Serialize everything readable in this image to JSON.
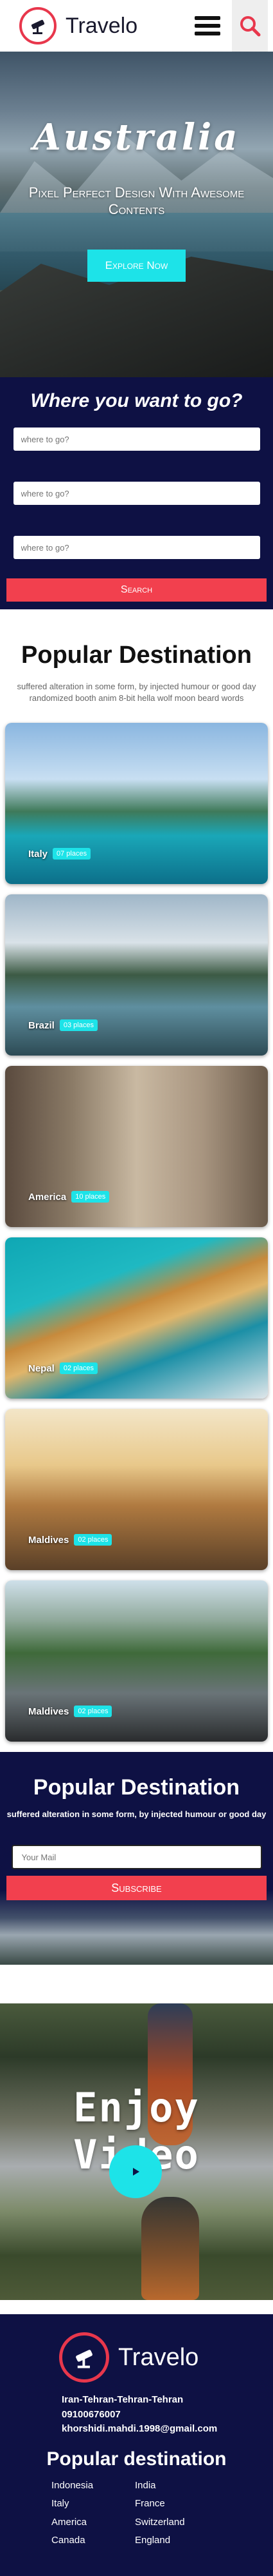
{
  "brand": {
    "name": "Travelo"
  },
  "nav": {
    "menu_icon": "hamburger-icon",
    "search_icon": "search-icon"
  },
  "hero": {
    "title": "Australia",
    "subtitle": "Pixel Perfect Design With Awesome Contents",
    "cta": "Explore Now"
  },
  "search": {
    "title": "Where you want to go?",
    "fields": [
      "where to go?",
      "where to go?",
      "where to go?"
    ],
    "button": "Search"
  },
  "popular": {
    "title": "Popular Destination",
    "description": "suffered alteration in some form, by injected humour or good day randomized booth anim 8-bit hella wolf moon beard words"
  },
  "cards": [
    {
      "name": "Italy",
      "badge": "07 places"
    },
    {
      "name": "Brazil",
      "badge": "03 places"
    },
    {
      "name": "America",
      "badge": "10 places"
    },
    {
      "name": "Nepal",
      "badge": "02 places"
    },
    {
      "name": "Maldives",
      "badge": "02 places"
    },
    {
      "name": "Maldives",
      "badge": "02 places"
    }
  ],
  "newsletter": {
    "title": "Popular Destination",
    "description": "suffered alteration in some form, by injected humour or good day",
    "placeholder": "Your Mail",
    "button": "Subscribe"
  },
  "video": {
    "title": "Enjoy Video",
    "play_icon": "play-icon"
  },
  "footer": {
    "brand": "Travelo",
    "address": "Iran-Tehran-Tehran-Tehran",
    "phone": "09100676007",
    "email": "khorshidi.mahdi.1998@gmail.com",
    "title": "Popular destination",
    "destinations": [
      "Indonesia",
      "India",
      "Italy",
      "France",
      "America",
      "Switzerland",
      "Canada",
      "England"
    ]
  },
  "colors": {
    "accent": "#e8374c",
    "navy": "#0e1144",
    "cyan": "#1de3e8",
    "button_red": "#f2404e"
  }
}
